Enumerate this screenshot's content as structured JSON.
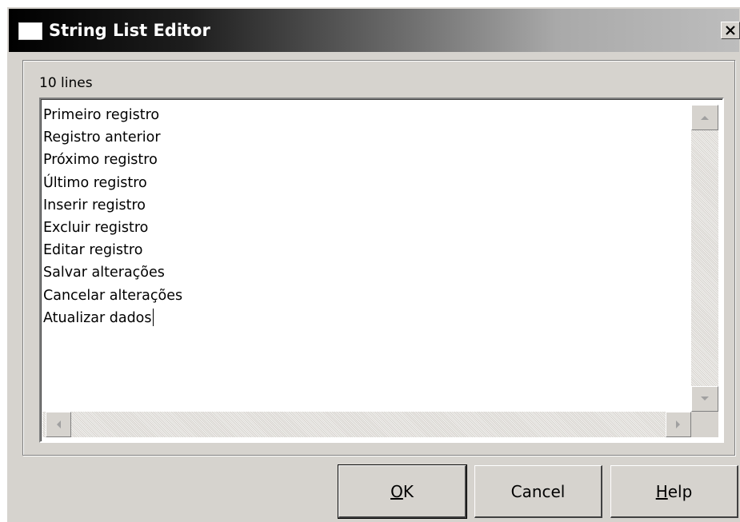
{
  "window": {
    "title": "String List Editor",
    "close_icon": "close-x-icon",
    "app_icon": "window-icon"
  },
  "editor": {
    "line_count_label": "10 lines",
    "lines": [
      "Primeiro registro",
      "Registro anterior",
      "Próximo registro",
      "Último registro",
      "Inserir registro",
      "Excluir registro",
      "Editar registro",
      "Salvar alterações",
      "Cancelar alterações",
      "Atualizar dados"
    ]
  },
  "buttons": {
    "ok": {
      "accel": "O",
      "rest": "K"
    },
    "cancel": "Cancel",
    "help": {
      "accel": "H",
      "rest": "elp"
    }
  },
  "colors": {
    "face": "#d6d3ce",
    "title_start": "#000000",
    "title_end": "#bdbdbd"
  }
}
